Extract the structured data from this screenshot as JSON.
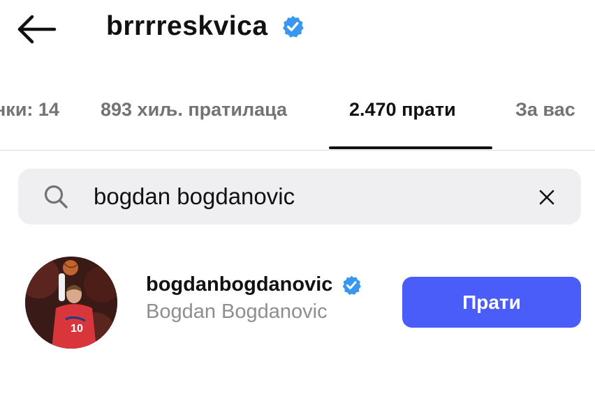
{
  "header": {
    "username": "brrrreskvica",
    "back_icon": "arrow-left-icon",
    "verified_icon": "verified-badge-icon",
    "verified_color": "#3897f0"
  },
  "tabs": [
    {
      "label": "нки: 14",
      "active": false
    },
    {
      "label": "893 хиљ. пратилаца",
      "active": false
    },
    {
      "label": "2.470 прати",
      "active": true
    },
    {
      "label": "За вас",
      "active": false
    }
  ],
  "search": {
    "value": "bogdan bogdanovic",
    "search_icon": "search-icon",
    "clear_icon": "close-icon"
  },
  "results": [
    {
      "username": "bogdanbogdanovic",
      "full_name": "Bogdan Bogdanovic",
      "verified": true,
      "follow_label": "Прати",
      "follow_color": "#4a5df9"
    }
  ]
}
